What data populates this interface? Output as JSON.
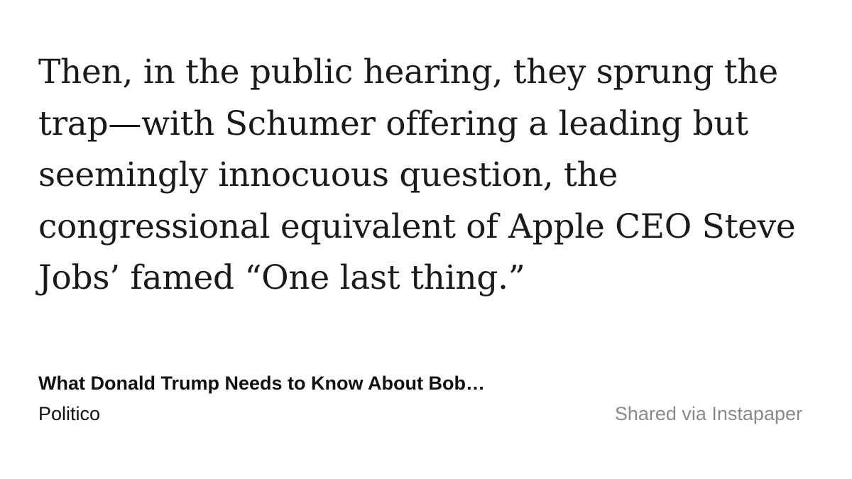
{
  "quote": {
    "lines": [
      "Then, in the public hearing, they sprung the",
      "trap—with Schumer offering a leading but",
      "seemingly innocuous question, the",
      "congressional equivalent of Apple CEO Steve",
      "Jobs’ famed “One last thing.”"
    ]
  },
  "article": {
    "title": "What Donald Trump Needs to Know About Bob…",
    "publication": "Politico"
  },
  "footer": {
    "shared_via": "Shared via Instapaper"
  },
  "colors": {
    "background": "#ffffff",
    "text": "#1a1a1a",
    "muted": "#8a8a8a"
  }
}
